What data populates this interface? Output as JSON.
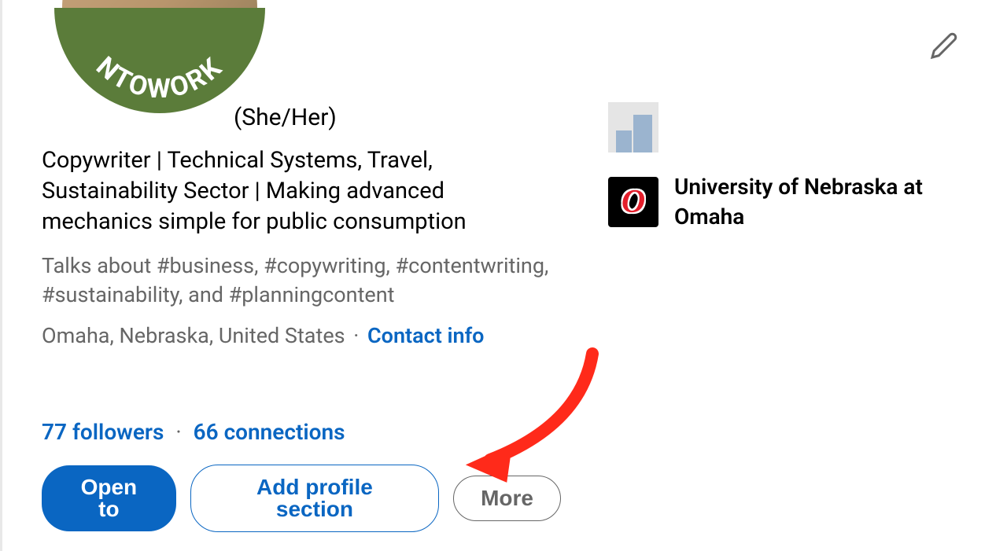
{
  "profile": {
    "open_to_work_text": "NTOWORK",
    "pronouns": "(She/Her)",
    "headline": "Copywriter | Technical Systems, Travel, Sustainability Sector | Making advanced mechanics simple for public consumption",
    "talks_about": "Talks about #business, #copywriting, #contentwriting, #sustainability, and #planningcontent",
    "location": "Omaha, Nebraska, United States",
    "contact_info_label": "Contact info",
    "followers_count": "77",
    "followers_label": "followers",
    "connections_count": "66",
    "connections_label": "connections"
  },
  "buttons": {
    "open_to": "Open to",
    "add_section": "Add profile section",
    "more": "More"
  },
  "education": {
    "university_name": "University of Nebraska at Omaha",
    "university_logo_letter": "O"
  }
}
